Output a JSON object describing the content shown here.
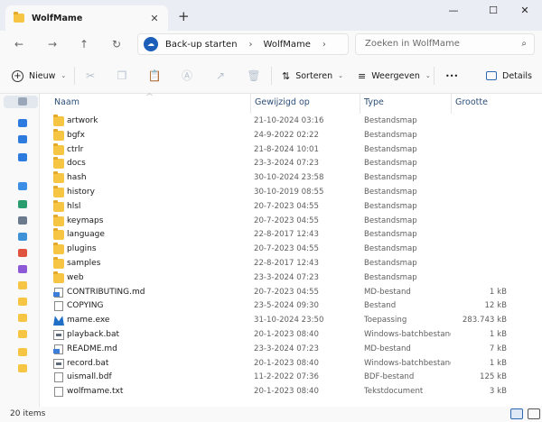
{
  "window": {
    "tab_title": "WolfMame",
    "new_tab": "+",
    "minimize": "—",
    "maximize": "☐",
    "close": "✕",
    "tab_close": "✕"
  },
  "nav": {
    "back": "←",
    "forward": "→",
    "up": "↑",
    "refresh": "↻",
    "breadcrumb": [
      "Back-up starten",
      "WolfMame"
    ],
    "search_placeholder": "Zoeken in WolfMame"
  },
  "commands": {
    "new_label": "Nieuw",
    "sort_label": "Sorteren",
    "view_label": "Weergeven",
    "more_label": "•••",
    "details_label": "Details"
  },
  "columns": {
    "name": "Naam",
    "modified": "Gewijzigd op",
    "type": "Type",
    "size": "Grootte"
  },
  "files": [
    {
      "name": "artwork",
      "modified": "21-10-2024 03:16",
      "type": "Bestandsmap",
      "size": "",
      "icon": "folder"
    },
    {
      "name": "bgfx",
      "modified": "24-9-2022 02:22",
      "type": "Bestandsmap",
      "size": "",
      "icon": "folder"
    },
    {
      "name": "ctrlr",
      "modified": "21-8-2024 10:01",
      "type": "Bestandsmap",
      "size": "",
      "icon": "folder"
    },
    {
      "name": "docs",
      "modified": "23-3-2024 07:23",
      "type": "Bestandsmap",
      "size": "",
      "icon": "folder"
    },
    {
      "name": "hash",
      "modified": "30-10-2024 23:58",
      "type": "Bestandsmap",
      "size": "",
      "icon": "folder"
    },
    {
      "name": "history",
      "modified": "30-10-2019 08:55",
      "type": "Bestandsmap",
      "size": "",
      "icon": "folder"
    },
    {
      "name": "hlsl",
      "modified": "20-7-2023 04:55",
      "type": "Bestandsmap",
      "size": "",
      "icon": "folder"
    },
    {
      "name": "keymaps",
      "modified": "20-7-2023 04:55",
      "type": "Bestandsmap",
      "size": "",
      "icon": "folder"
    },
    {
      "name": "language",
      "modified": "22-8-2017 12:43",
      "type": "Bestandsmap",
      "size": "",
      "icon": "folder"
    },
    {
      "name": "plugins",
      "modified": "20-7-2023 04:55",
      "type": "Bestandsmap",
      "size": "",
      "icon": "folder"
    },
    {
      "name": "samples",
      "modified": "22-8-2017 12:43",
      "type": "Bestandsmap",
      "size": "",
      "icon": "folder"
    },
    {
      "name": "web",
      "modified": "23-3-2024 07:23",
      "type": "Bestandsmap",
      "size": "",
      "icon": "folder"
    },
    {
      "name": "CONTRIBUTING.md",
      "modified": "20-7-2023 04:55",
      "type": "MD-bestand",
      "size": "1 kB",
      "icon": "md"
    },
    {
      "name": "COPYING",
      "modified": "23-5-2024 09:30",
      "type": "Bestand",
      "size": "12 kB",
      "icon": "doc"
    },
    {
      "name": "mame.exe",
      "modified": "31-10-2024 23:50",
      "type": "Toepassing",
      "size": "283.743 kB",
      "icon": "exe"
    },
    {
      "name": "playback.bat",
      "modified": "20-1-2023 08:40",
      "type": "Windows-batchbestand",
      "size": "1 kB",
      "icon": "bat"
    },
    {
      "name": "README.md",
      "modified": "23-3-2024 07:23",
      "type": "MD-bestand",
      "size": "7 kB",
      "icon": "md"
    },
    {
      "name": "record.bat",
      "modified": "20-1-2023 08:40",
      "type": "Windows-batchbestand",
      "size": "1 kB",
      "icon": "bat"
    },
    {
      "name": "uismall.bdf",
      "modified": "11-2-2022 07:36",
      "type": "BDF-bestand",
      "size": "125 kB",
      "icon": "doc"
    },
    {
      "name": "wolfmame.txt",
      "modified": "20-1-2023 08:40",
      "type": "Tekstdocument",
      "size": "3 kB",
      "icon": "doc"
    }
  ],
  "status": {
    "item_count": "20 items"
  },
  "colors": {
    "folder": "#f7c544",
    "accent": "#1c5fb8",
    "header_text": "#2d4f78"
  }
}
